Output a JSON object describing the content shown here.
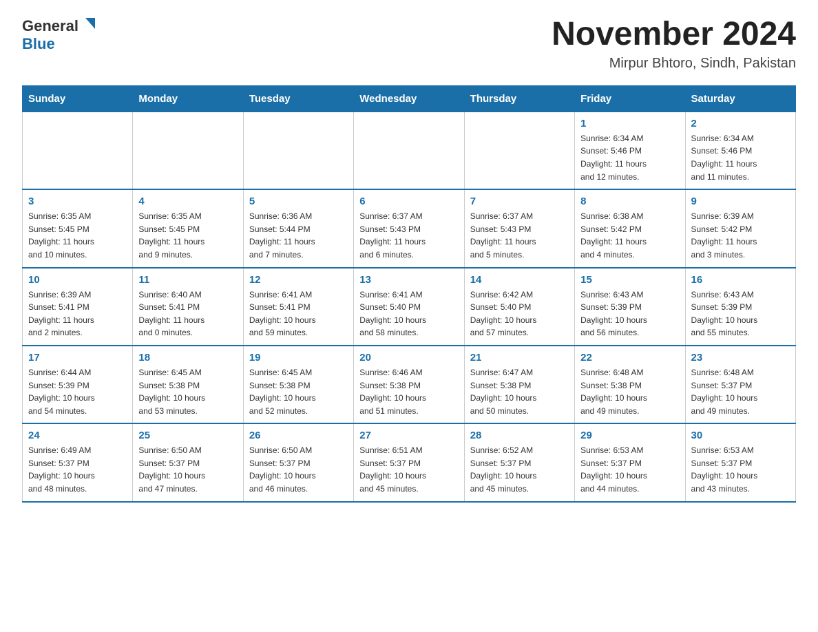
{
  "header": {
    "logo_general": "General",
    "logo_blue": "Blue",
    "month_title": "November 2024",
    "location": "Mirpur Bhtoro, Sindh, Pakistan"
  },
  "days_of_week": [
    "Sunday",
    "Monday",
    "Tuesday",
    "Wednesday",
    "Thursday",
    "Friday",
    "Saturday"
  ],
  "weeks": [
    [
      {
        "day": "",
        "info": ""
      },
      {
        "day": "",
        "info": ""
      },
      {
        "day": "",
        "info": ""
      },
      {
        "day": "",
        "info": ""
      },
      {
        "day": "",
        "info": ""
      },
      {
        "day": "1",
        "info": "Sunrise: 6:34 AM\nSunset: 5:46 PM\nDaylight: 11 hours\nand 12 minutes."
      },
      {
        "day": "2",
        "info": "Sunrise: 6:34 AM\nSunset: 5:46 PM\nDaylight: 11 hours\nand 11 minutes."
      }
    ],
    [
      {
        "day": "3",
        "info": "Sunrise: 6:35 AM\nSunset: 5:45 PM\nDaylight: 11 hours\nand 10 minutes."
      },
      {
        "day": "4",
        "info": "Sunrise: 6:35 AM\nSunset: 5:45 PM\nDaylight: 11 hours\nand 9 minutes."
      },
      {
        "day": "5",
        "info": "Sunrise: 6:36 AM\nSunset: 5:44 PM\nDaylight: 11 hours\nand 7 minutes."
      },
      {
        "day": "6",
        "info": "Sunrise: 6:37 AM\nSunset: 5:43 PM\nDaylight: 11 hours\nand 6 minutes."
      },
      {
        "day": "7",
        "info": "Sunrise: 6:37 AM\nSunset: 5:43 PM\nDaylight: 11 hours\nand 5 minutes."
      },
      {
        "day": "8",
        "info": "Sunrise: 6:38 AM\nSunset: 5:42 PM\nDaylight: 11 hours\nand 4 minutes."
      },
      {
        "day": "9",
        "info": "Sunrise: 6:39 AM\nSunset: 5:42 PM\nDaylight: 11 hours\nand 3 minutes."
      }
    ],
    [
      {
        "day": "10",
        "info": "Sunrise: 6:39 AM\nSunset: 5:41 PM\nDaylight: 11 hours\nand 2 minutes."
      },
      {
        "day": "11",
        "info": "Sunrise: 6:40 AM\nSunset: 5:41 PM\nDaylight: 11 hours\nand 0 minutes."
      },
      {
        "day": "12",
        "info": "Sunrise: 6:41 AM\nSunset: 5:41 PM\nDaylight: 10 hours\nand 59 minutes."
      },
      {
        "day": "13",
        "info": "Sunrise: 6:41 AM\nSunset: 5:40 PM\nDaylight: 10 hours\nand 58 minutes."
      },
      {
        "day": "14",
        "info": "Sunrise: 6:42 AM\nSunset: 5:40 PM\nDaylight: 10 hours\nand 57 minutes."
      },
      {
        "day": "15",
        "info": "Sunrise: 6:43 AM\nSunset: 5:39 PM\nDaylight: 10 hours\nand 56 minutes."
      },
      {
        "day": "16",
        "info": "Sunrise: 6:43 AM\nSunset: 5:39 PM\nDaylight: 10 hours\nand 55 minutes."
      }
    ],
    [
      {
        "day": "17",
        "info": "Sunrise: 6:44 AM\nSunset: 5:39 PM\nDaylight: 10 hours\nand 54 minutes."
      },
      {
        "day": "18",
        "info": "Sunrise: 6:45 AM\nSunset: 5:38 PM\nDaylight: 10 hours\nand 53 minutes."
      },
      {
        "day": "19",
        "info": "Sunrise: 6:45 AM\nSunset: 5:38 PM\nDaylight: 10 hours\nand 52 minutes."
      },
      {
        "day": "20",
        "info": "Sunrise: 6:46 AM\nSunset: 5:38 PM\nDaylight: 10 hours\nand 51 minutes."
      },
      {
        "day": "21",
        "info": "Sunrise: 6:47 AM\nSunset: 5:38 PM\nDaylight: 10 hours\nand 50 minutes."
      },
      {
        "day": "22",
        "info": "Sunrise: 6:48 AM\nSunset: 5:38 PM\nDaylight: 10 hours\nand 49 minutes."
      },
      {
        "day": "23",
        "info": "Sunrise: 6:48 AM\nSunset: 5:37 PM\nDaylight: 10 hours\nand 49 minutes."
      }
    ],
    [
      {
        "day": "24",
        "info": "Sunrise: 6:49 AM\nSunset: 5:37 PM\nDaylight: 10 hours\nand 48 minutes."
      },
      {
        "day": "25",
        "info": "Sunrise: 6:50 AM\nSunset: 5:37 PM\nDaylight: 10 hours\nand 47 minutes."
      },
      {
        "day": "26",
        "info": "Sunrise: 6:50 AM\nSunset: 5:37 PM\nDaylight: 10 hours\nand 46 minutes."
      },
      {
        "day": "27",
        "info": "Sunrise: 6:51 AM\nSunset: 5:37 PM\nDaylight: 10 hours\nand 45 minutes."
      },
      {
        "day": "28",
        "info": "Sunrise: 6:52 AM\nSunset: 5:37 PM\nDaylight: 10 hours\nand 45 minutes."
      },
      {
        "day": "29",
        "info": "Sunrise: 6:53 AM\nSunset: 5:37 PM\nDaylight: 10 hours\nand 44 minutes."
      },
      {
        "day": "30",
        "info": "Sunrise: 6:53 AM\nSunset: 5:37 PM\nDaylight: 10 hours\nand 43 minutes."
      }
    ]
  ]
}
